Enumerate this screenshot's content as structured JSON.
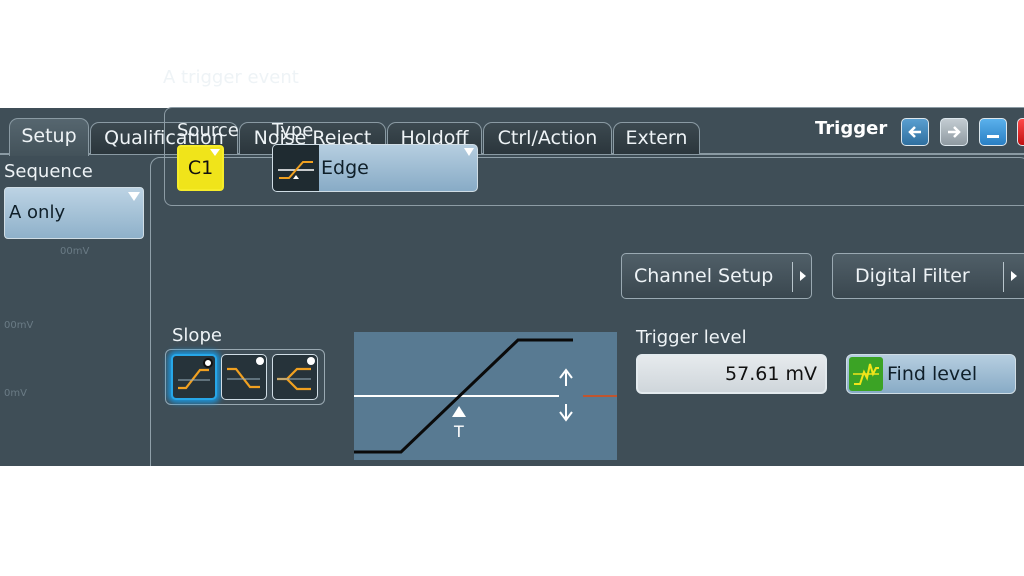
{
  "header": {
    "title": "Trigger",
    "tabs": [
      {
        "label": "Setup",
        "active": true
      },
      {
        "label": "Qualification",
        "active": false
      },
      {
        "label": "Noise Reject",
        "active": false
      },
      {
        "label": "Holdoff",
        "active": false
      },
      {
        "label": "Ctrl/Action",
        "active": false
      },
      {
        "label": "Extern",
        "active": false
      }
    ],
    "window_buttons": [
      "arrow-left-icon",
      "arrow-right-icon",
      "minimize-icon",
      "close-icon"
    ]
  },
  "sequence": {
    "label": "Sequence",
    "value": "A only"
  },
  "event": {
    "label": "A trigger event",
    "source_label": "Source",
    "source_value": "C1",
    "type_label": "Type",
    "type_value": "Edge",
    "channel_setup_label": "Channel Setup",
    "digital_filter_label": "Digital Filter"
  },
  "slope": {
    "label": "Slope",
    "options": [
      "rising",
      "falling",
      "either"
    ],
    "selected": "rising"
  },
  "diagram": {
    "marker_label": "T"
  },
  "trigger_level": {
    "label": "Trigger level",
    "value": "57.61 mV",
    "find_label": "Find level"
  },
  "colors": {
    "panel": "#3f4e57",
    "source_c1": "#f0e41a",
    "accent_blue": "#27a7e8",
    "find_green": "#3ba325",
    "edge_trace": "#f0a020"
  }
}
